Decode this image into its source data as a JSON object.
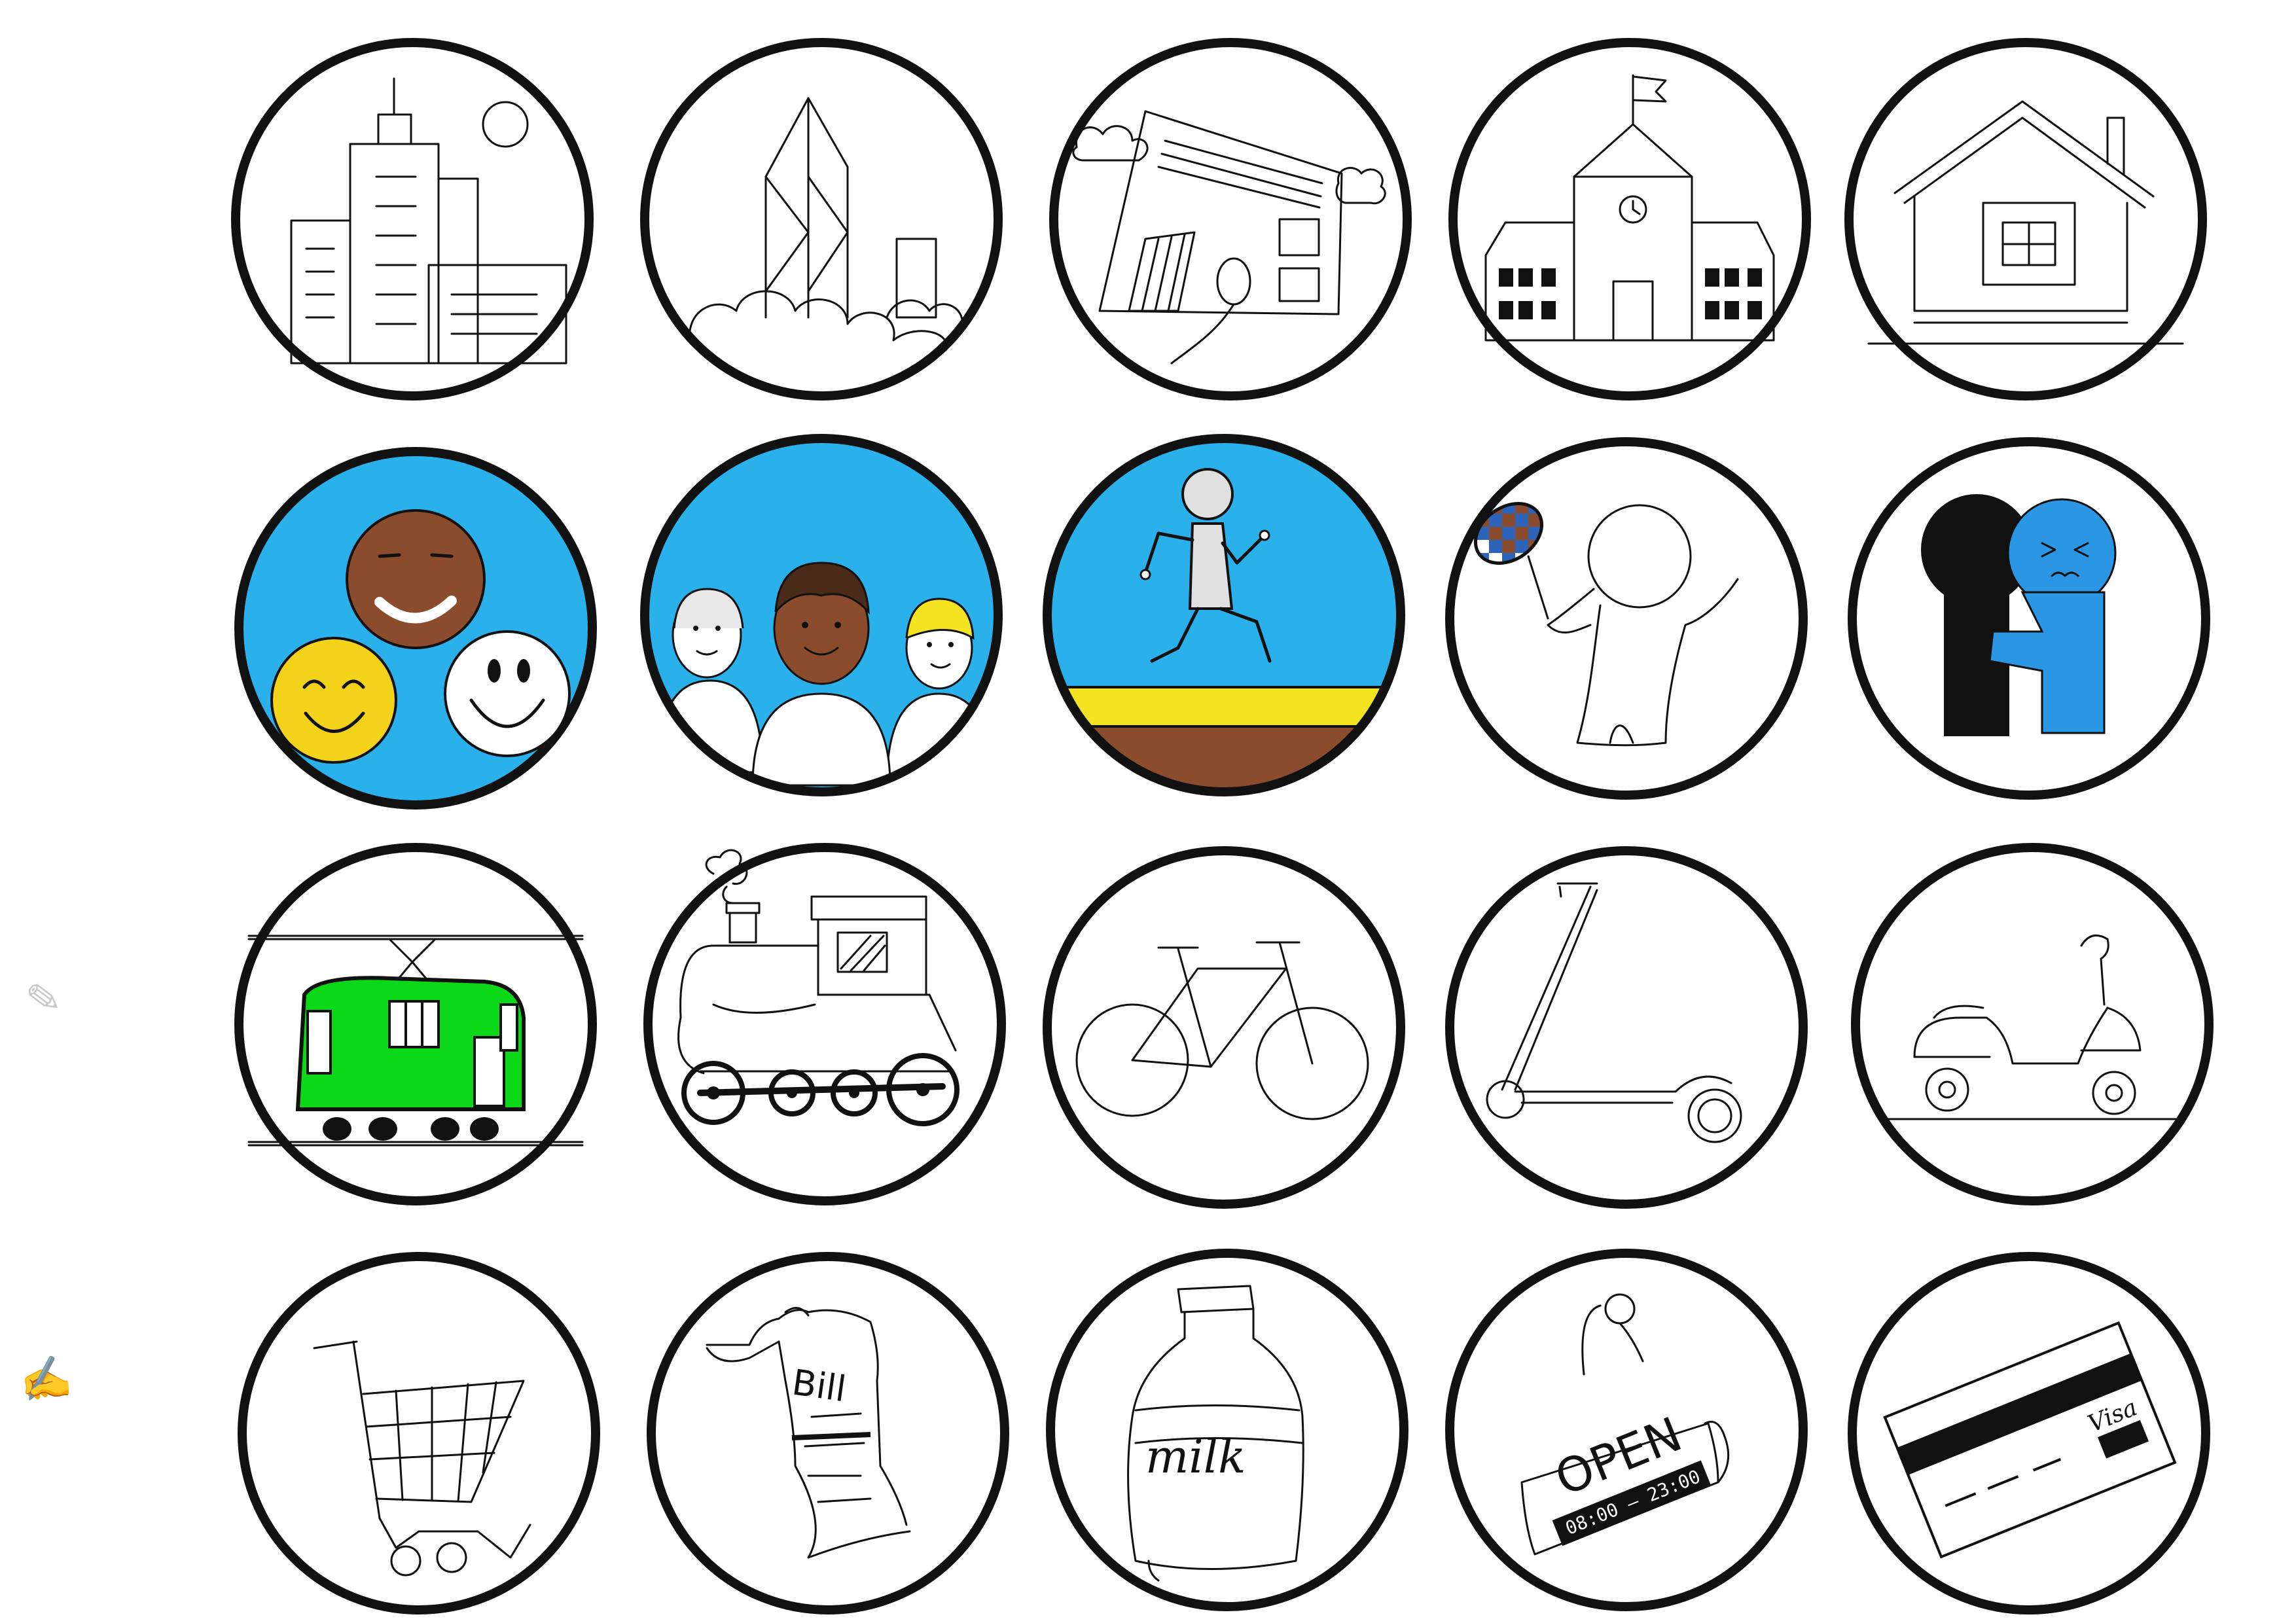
{
  "colors": {
    "outline": "#111111",
    "sky_blue": "#29aee8",
    "deep_blue": "#2b96e4",
    "yellow": "#f2d31a",
    "brown": "#8b4a2b",
    "green": "#0bd917",
    "grey_faint": "#d4d4d4"
  },
  "rows": [
    {
      "name": "places",
      "icons": [
        {
          "name": "city-skyline-icon"
        },
        {
          "name": "skyscraper-clouds-icon"
        },
        {
          "name": "office-building-icon"
        },
        {
          "name": "school-building-icon"
        },
        {
          "name": "house-icon"
        }
      ]
    },
    {
      "name": "people",
      "icons": [
        {
          "name": "smiley-faces-icon"
        },
        {
          "name": "three-people-icon"
        },
        {
          "name": "running-figure-icon"
        },
        {
          "name": "badminton-player-icon"
        },
        {
          "name": "hugging-figures-icon"
        }
      ]
    },
    {
      "name": "transport",
      "icons": [
        {
          "name": "tram-icon"
        },
        {
          "name": "steam-train-icon"
        },
        {
          "name": "bicycle-icon"
        },
        {
          "name": "kick-scooter-icon"
        },
        {
          "name": "motor-scooter-icon"
        }
      ]
    },
    {
      "name": "shopping",
      "icons": [
        {
          "name": "shopping-cart-icon"
        },
        {
          "name": "bill-receipt-icon",
          "text": "Bill"
        },
        {
          "name": "milk-bottle-icon",
          "text": "milk"
        },
        {
          "name": "open-sign-icon",
          "text": "OPEN",
          "hours": "08:00 — 23:00"
        },
        {
          "name": "credit-card-icon",
          "text": "Visa"
        }
      ]
    }
  ]
}
